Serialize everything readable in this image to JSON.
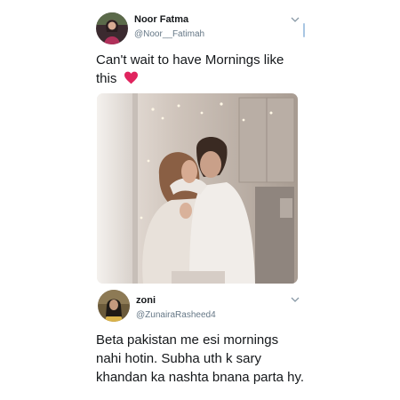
{
  "tweet": {
    "author_name": "Noor Fatma",
    "author_handle": "@Noor__Fatimah",
    "text": "Can't wait to have Mornings like this",
    "emoji_icon": "red-heart-icon",
    "media_description_icon": "photo-couple-kitchen-icon"
  },
  "reply": {
    "author_name": "zoni",
    "author_handle": "@ZunairaRasheed4",
    "text": "Beta pakistan me esi mornings nahi hotin. Subha uth k sary khandan ka nashta bnana parta hy."
  },
  "colors": {
    "text_primary": "#14171a",
    "text_secondary": "#657786",
    "heart": "#e0245e",
    "scroll_indicator": "#a9c6e3"
  }
}
